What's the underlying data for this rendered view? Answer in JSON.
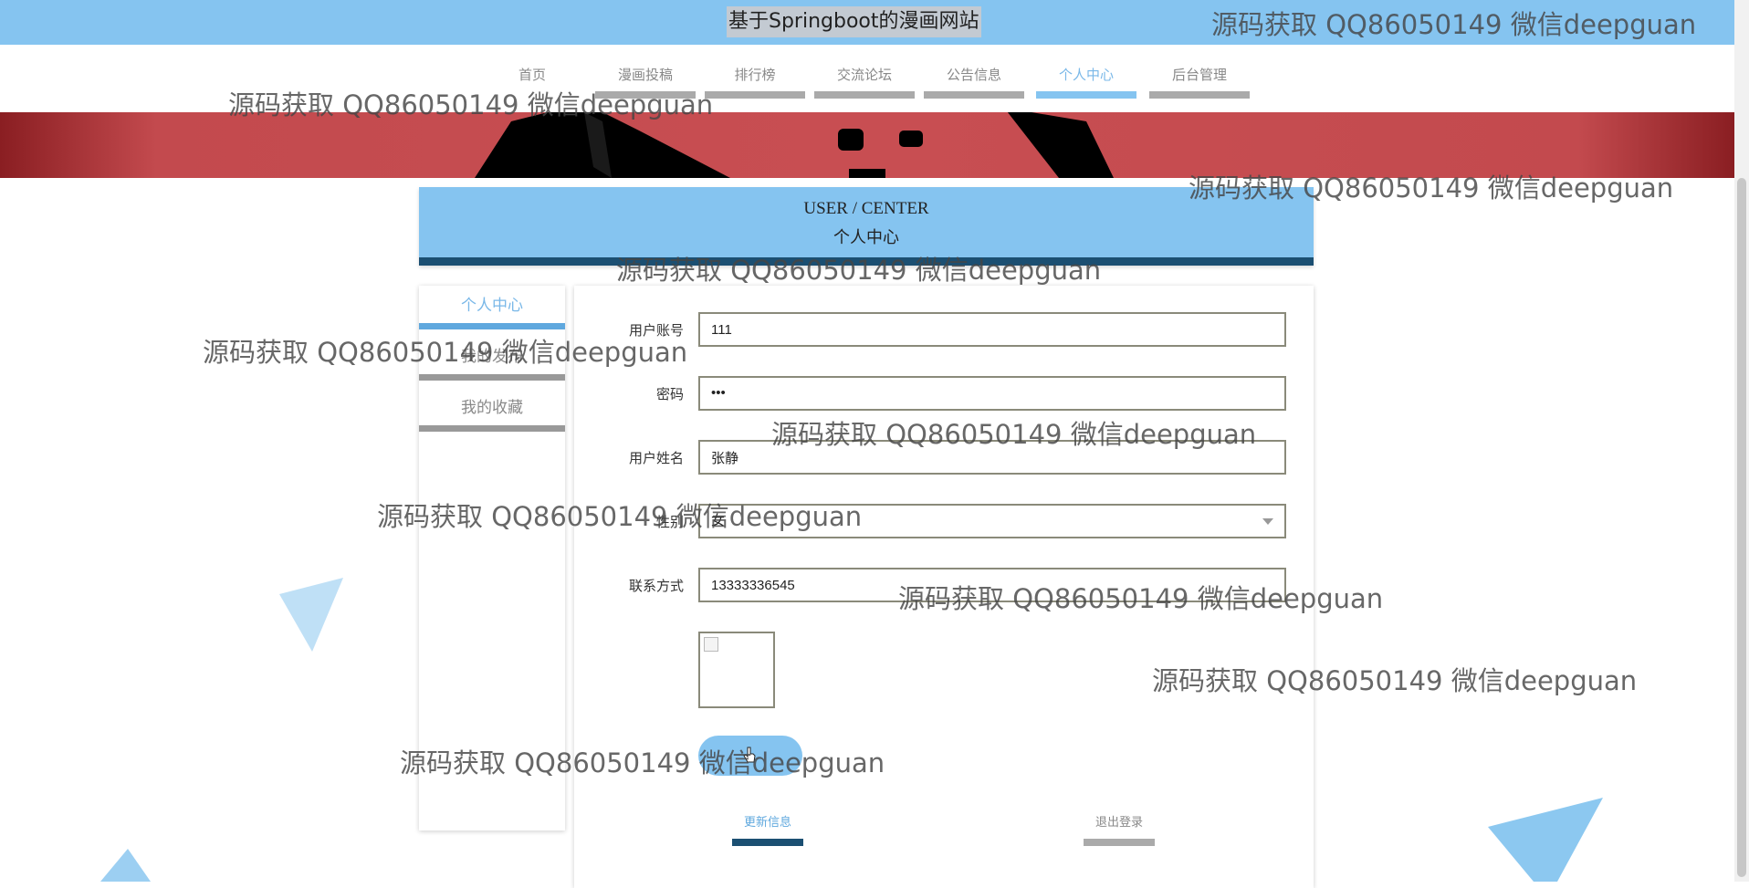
{
  "header": {
    "site_title": "基于Springboot的漫画网站"
  },
  "nav": [
    {
      "label": "首页"
    },
    {
      "label": "漫画投稿"
    },
    {
      "label": "排行榜"
    },
    {
      "label": "交流论坛"
    },
    {
      "label": "公告信息"
    },
    {
      "label": "个人中心"
    },
    {
      "label": "后台管理"
    }
  ],
  "panel": {
    "title_en": "USER / CENTER",
    "title_cn": "个人中心"
  },
  "side_menu": [
    {
      "label": "个人中心"
    },
    {
      "label": "我的发布"
    },
    {
      "label": "我的收藏"
    }
  ],
  "form": {
    "account": {
      "label": "用户账号",
      "value": "111"
    },
    "password": {
      "label": "密码",
      "value": "•••"
    },
    "name": {
      "label": "用户姓名",
      "value": "张静"
    },
    "gender": {
      "label": "性别",
      "value": "女"
    },
    "phone": {
      "label": "联系方式",
      "value": "13333336545"
    }
  },
  "buttons": {
    "update": "更新信息",
    "logout": "退出登录"
  },
  "watermark": "源码获取 QQ86050149 微信deepguan",
  "colors": {
    "accent": "#85c4f0",
    "dark_accent": "#1b4f72",
    "banner_red": "#c84e52"
  }
}
